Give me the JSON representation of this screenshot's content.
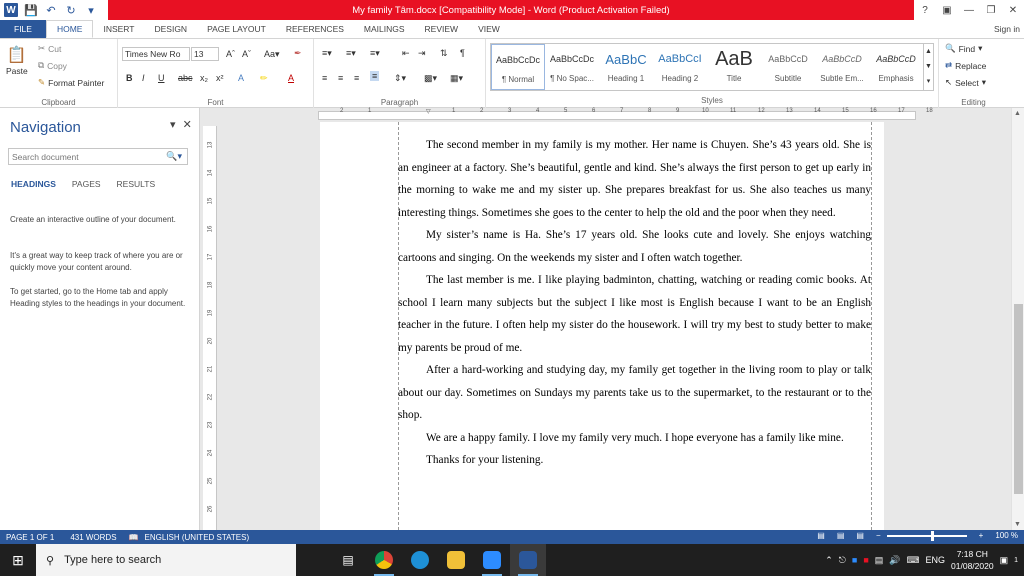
{
  "titlebar": {
    "title": "My family Tâm.docx [Compatibility Mode] - Word (Product Activation Failed)",
    "help": "?",
    "sign_in": "Sign in"
  },
  "tabs": [
    "FILE",
    "HOME",
    "INSERT",
    "DESIGN",
    "PAGE LAYOUT",
    "REFERENCES",
    "MAILINGS",
    "REVIEW",
    "VIEW"
  ],
  "clipboard": {
    "paste": "Paste",
    "cut": "Cut",
    "copy": "Copy",
    "format_painter": "Format Painter",
    "label": "Clipboard"
  },
  "font": {
    "family": "Times New Ro",
    "size": "13",
    "label": "Font"
  },
  "paragraph": {
    "label": "Paragraph"
  },
  "styles": {
    "label": "Styles",
    "items": [
      {
        "preview": "AaBbCcDc",
        "name": "¶ Normal"
      },
      {
        "preview": "AaBbCcDc",
        "name": "¶ No Spac..."
      },
      {
        "preview": "AaBbC",
        "name": "Heading 1"
      },
      {
        "preview": "AaBbCcI",
        "name": "Heading 2"
      },
      {
        "preview": "AaB",
        "name": "Title"
      },
      {
        "preview": "AaBbCcD",
        "name": "Subtitle"
      },
      {
        "preview": "AaBbCcD",
        "name": "Subtle Em..."
      },
      {
        "preview": "AaBbCcD",
        "name": "Emphasis"
      }
    ]
  },
  "editing": {
    "find": "Find",
    "replace": "Replace",
    "select": "Select",
    "label": "Editing"
  },
  "navigation": {
    "title": "Navigation",
    "search_placeholder": "Search document",
    "tabs": [
      "HEADINGS",
      "PAGES",
      "RESULTS"
    ],
    "text1": "Create an interactive outline of your document.",
    "text2": "It's a great way to keep track of where you are or quickly move your content around.",
    "text3": "To get started, go to the Home tab and apply Heading styles to the headings in your document."
  },
  "document": {
    "paragraphs": [
      "The second member in my family is my mother. Her name is Chuyen. She’s 43 years old. She is an engineer at a factory. She’s beautiful, gentle and kind. She’s always the first person to get up early in the morning to wake me and my sister up. She prepares breakfast for us. She also teaches us many interesting things. Sometimes she goes to the center to help the old and the poor when they need.",
      "My sister’s name is Ha. She’s 17 years old. She looks cute and lovely. She enjoys watching cartoons and singing. On the weekends my sister and I often watch together.",
      "The last member is me. I like playing badminton, chatting, watching or reading comic books. At school I learn many subjects but the subject I like most is English because I want to be an English teacher in the future. I often help my sister do the housework. I will try my best to study better to make my parents be proud of me.",
      "After a hard-working and studying day, my family get together in the living room to play or talk about our day. Sometimes on Sundays my parents take us to the supermarket, to the restaurant or to the shop.",
      "We are a happy family. I love my family very much. I hope everyone has a family like mine.",
      "Thanks for your listening."
    ]
  },
  "statusbar": {
    "page": "PAGE 1 OF 1",
    "words": "431 WORDS",
    "language": "ENGLISH (UNITED STATES)",
    "zoom": "100 %"
  },
  "taskbar": {
    "search_placeholder": "Type here to search",
    "lang": "ENG",
    "time": "7:18 CH",
    "date": "01/08/2020",
    "notification_count": "1"
  }
}
